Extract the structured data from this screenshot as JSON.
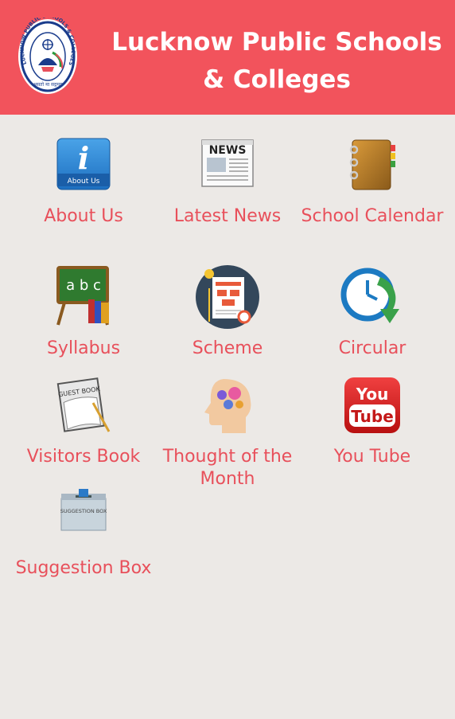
{
  "header": {
    "title_line1": "Lucknow Public Schools",
    "title_line2": "& Colleges",
    "logo_ring_text": "LUCKNOW PUBLIC SCHOOLS & COLLEGES",
    "logo_motto": "असतो मा सद्गमय",
    "background_color": "#f2535c"
  },
  "tiles": [
    {
      "label": "About Us",
      "icon": "info-icon",
      "icon_text": "About Us"
    },
    {
      "label": "Latest News",
      "icon": "newspaper-icon",
      "icon_text": "NEWS"
    },
    {
      "label": "School Calendar",
      "icon": "calendar-icon"
    },
    {
      "label": "Syllabus",
      "icon": "chalkboard-icon",
      "icon_text": "a b c"
    },
    {
      "label": "Scheme",
      "icon": "scheme-document-icon"
    },
    {
      "label": "Circular",
      "icon": "clock-refresh-icon"
    },
    {
      "label": "Visitors Book",
      "icon": "guest-book-icon",
      "icon_text": "GUEST BOOK"
    },
    {
      "label": "Thought of the Month",
      "icon": "brain-gears-icon"
    },
    {
      "label": "You Tube",
      "icon": "youtube-icon",
      "icon_text_1": "You",
      "icon_text_2": "Tube"
    },
    {
      "label": "Suggestion Box",
      "icon": "suggestion-box-icon",
      "icon_text": "SUGGESTION BOX"
    }
  ]
}
